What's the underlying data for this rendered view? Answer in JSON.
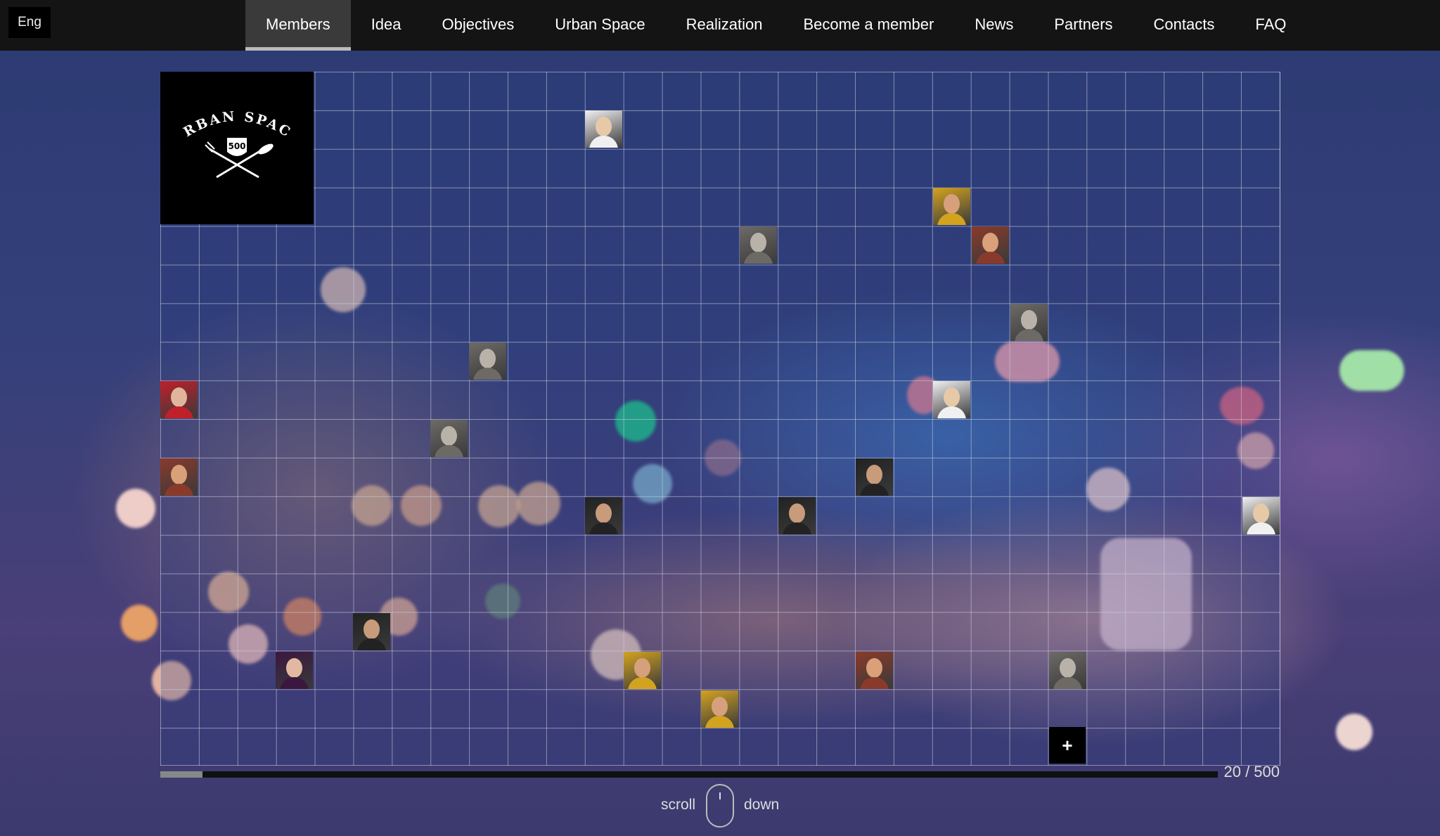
{
  "language": "Eng",
  "nav": [
    {
      "label": "Members",
      "active": true
    },
    {
      "label": "Idea"
    },
    {
      "label": "Objectives"
    },
    {
      "label": "Urban Space"
    },
    {
      "label": "Realization"
    },
    {
      "label": "Become a member"
    },
    {
      "label": "News"
    },
    {
      "label": "Partners"
    },
    {
      "label": "Contacts"
    },
    {
      "label": "FAQ"
    }
  ],
  "logo": {
    "line1": "URBAN SPACE",
    "badge": "500"
  },
  "members_count": "20 / 500",
  "scroll_progress": 0.04,
  "scroll_hint": {
    "left": "scroll",
    "right": "down"
  },
  "add_button": "+",
  "avatar_colors": {
    "gray": [
      "#b9b2a8",
      "#6d6a66"
    ],
    "warm": [
      "#d9a07a",
      "#8a3a2a"
    ],
    "dark": [
      "#c89b7b",
      "#222222"
    ],
    "red": [
      "#e0b59b",
      "#c0202a"
    ],
    "light": [
      "#e7c9a8",
      "#f0f0f0"
    ],
    "yellow": [
      "#d6a07c",
      "#d3a31f"
    ],
    "purple": [
      "#e2b9a0",
      "#3b1740"
    ]
  }
}
